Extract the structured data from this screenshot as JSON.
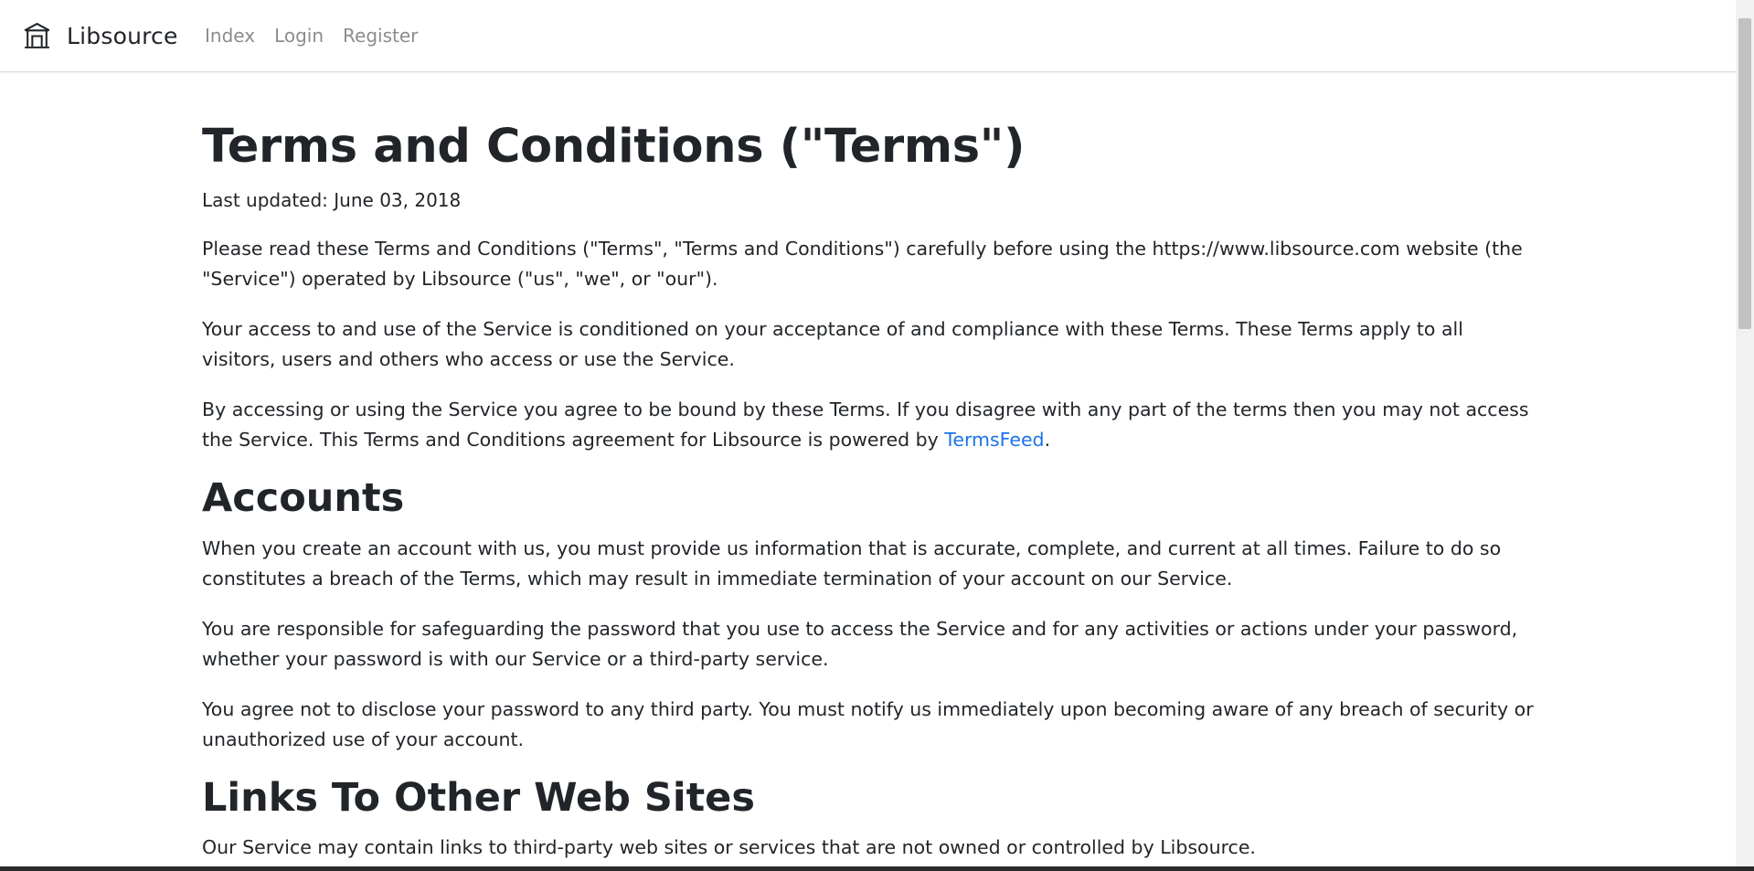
{
  "navbar": {
    "brand_icon": "bank-building-icon",
    "brand": "Libsource",
    "links": [
      "Index",
      "Login",
      "Register"
    ]
  },
  "main": {
    "title": "Terms and Conditions (\"Terms\")",
    "last_updated": "Last updated: June 03, 2018",
    "intro": [
      "Please read these Terms and Conditions (\"Terms\", \"Terms and Conditions\") carefully before using the https://www.libsource.com website (the \"Service\") operated by Libsource (\"us\", \"we\", or \"our\").",
      "Your access to and use of the Service is conditioned on your acceptance of and compliance with these Terms. These Terms apply to all visitors, users and others who access or use the Service."
    ],
    "intro3_before": "By accessing or using the Service you agree to be bound by these Terms. If you disagree with any part of the terms then you may not access the Service. This Terms and Conditions agreement for Libsource is powered by ",
    "intro3_link": "TermsFeed",
    "intro3_after": ".",
    "sections": [
      {
        "heading": "Accounts",
        "paragraphs": [
          "When you create an account with us, you must provide us information that is accurate, complete, and current at all times. Failure to do so constitutes a breach of the Terms, which may result in immediate termination of your account on our Service.",
          "You are responsible for safeguarding the password that you use to access the Service and for any activities or actions under your password, whether your password is with our Service or a third-party service.",
          "You agree not to disclose your password to any third party. You must notify us immediately upon becoming aware of any breach of security or unauthorized use of your account."
        ]
      },
      {
        "heading": "Links To Other Web Sites",
        "paragraphs": [
          "Our Service may contain links to third-party web sites or services that are not owned or controlled by Libsource."
        ]
      }
    ]
  },
  "colors": {
    "text": "#212529",
    "nav_link": "#8a8d90",
    "link": "#1a73e8"
  }
}
